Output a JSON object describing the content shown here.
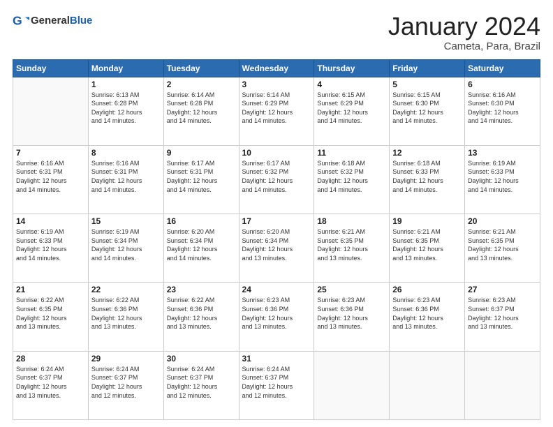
{
  "logo": {
    "general": "General",
    "blue": "Blue"
  },
  "header": {
    "title": "January 2024",
    "subtitle": "Cameta, Para, Brazil"
  },
  "weekdays": [
    "Sunday",
    "Monday",
    "Tuesday",
    "Wednesday",
    "Thursday",
    "Friday",
    "Saturday"
  ],
  "weeks": [
    [
      {
        "day": "",
        "info": ""
      },
      {
        "day": "1",
        "info": "Sunrise: 6:13 AM\nSunset: 6:28 PM\nDaylight: 12 hours\nand 14 minutes."
      },
      {
        "day": "2",
        "info": "Sunrise: 6:14 AM\nSunset: 6:28 PM\nDaylight: 12 hours\nand 14 minutes."
      },
      {
        "day": "3",
        "info": "Sunrise: 6:14 AM\nSunset: 6:29 PM\nDaylight: 12 hours\nand 14 minutes."
      },
      {
        "day": "4",
        "info": "Sunrise: 6:15 AM\nSunset: 6:29 PM\nDaylight: 12 hours\nand 14 minutes."
      },
      {
        "day": "5",
        "info": "Sunrise: 6:15 AM\nSunset: 6:30 PM\nDaylight: 12 hours\nand 14 minutes."
      },
      {
        "day": "6",
        "info": "Sunrise: 6:16 AM\nSunset: 6:30 PM\nDaylight: 12 hours\nand 14 minutes."
      }
    ],
    [
      {
        "day": "7",
        "info": "Sunrise: 6:16 AM\nSunset: 6:31 PM\nDaylight: 12 hours\nand 14 minutes."
      },
      {
        "day": "8",
        "info": "Sunrise: 6:16 AM\nSunset: 6:31 PM\nDaylight: 12 hours\nand 14 minutes."
      },
      {
        "day": "9",
        "info": "Sunrise: 6:17 AM\nSunset: 6:31 PM\nDaylight: 12 hours\nand 14 minutes."
      },
      {
        "day": "10",
        "info": "Sunrise: 6:17 AM\nSunset: 6:32 PM\nDaylight: 12 hours\nand 14 minutes."
      },
      {
        "day": "11",
        "info": "Sunrise: 6:18 AM\nSunset: 6:32 PM\nDaylight: 12 hours\nand 14 minutes."
      },
      {
        "day": "12",
        "info": "Sunrise: 6:18 AM\nSunset: 6:33 PM\nDaylight: 12 hours\nand 14 minutes."
      },
      {
        "day": "13",
        "info": "Sunrise: 6:19 AM\nSunset: 6:33 PM\nDaylight: 12 hours\nand 14 minutes."
      }
    ],
    [
      {
        "day": "14",
        "info": "Sunrise: 6:19 AM\nSunset: 6:33 PM\nDaylight: 12 hours\nand 14 minutes."
      },
      {
        "day": "15",
        "info": "Sunrise: 6:19 AM\nSunset: 6:34 PM\nDaylight: 12 hours\nand 14 minutes."
      },
      {
        "day": "16",
        "info": "Sunrise: 6:20 AM\nSunset: 6:34 PM\nDaylight: 12 hours\nand 14 minutes."
      },
      {
        "day": "17",
        "info": "Sunrise: 6:20 AM\nSunset: 6:34 PM\nDaylight: 12 hours\nand 13 minutes."
      },
      {
        "day": "18",
        "info": "Sunrise: 6:21 AM\nSunset: 6:35 PM\nDaylight: 12 hours\nand 13 minutes."
      },
      {
        "day": "19",
        "info": "Sunrise: 6:21 AM\nSunset: 6:35 PM\nDaylight: 12 hours\nand 13 minutes."
      },
      {
        "day": "20",
        "info": "Sunrise: 6:21 AM\nSunset: 6:35 PM\nDaylight: 12 hours\nand 13 minutes."
      }
    ],
    [
      {
        "day": "21",
        "info": "Sunrise: 6:22 AM\nSunset: 6:35 PM\nDaylight: 12 hours\nand 13 minutes."
      },
      {
        "day": "22",
        "info": "Sunrise: 6:22 AM\nSunset: 6:36 PM\nDaylight: 12 hours\nand 13 minutes."
      },
      {
        "day": "23",
        "info": "Sunrise: 6:22 AM\nSunset: 6:36 PM\nDaylight: 12 hours\nand 13 minutes."
      },
      {
        "day": "24",
        "info": "Sunrise: 6:23 AM\nSunset: 6:36 PM\nDaylight: 12 hours\nand 13 minutes."
      },
      {
        "day": "25",
        "info": "Sunrise: 6:23 AM\nSunset: 6:36 PM\nDaylight: 12 hours\nand 13 minutes."
      },
      {
        "day": "26",
        "info": "Sunrise: 6:23 AM\nSunset: 6:36 PM\nDaylight: 12 hours\nand 13 minutes."
      },
      {
        "day": "27",
        "info": "Sunrise: 6:23 AM\nSunset: 6:37 PM\nDaylight: 12 hours\nand 13 minutes."
      }
    ],
    [
      {
        "day": "28",
        "info": "Sunrise: 6:24 AM\nSunset: 6:37 PM\nDaylight: 12 hours\nand 13 minutes."
      },
      {
        "day": "29",
        "info": "Sunrise: 6:24 AM\nSunset: 6:37 PM\nDaylight: 12 hours\nand 12 minutes."
      },
      {
        "day": "30",
        "info": "Sunrise: 6:24 AM\nSunset: 6:37 PM\nDaylight: 12 hours\nand 12 minutes."
      },
      {
        "day": "31",
        "info": "Sunrise: 6:24 AM\nSunset: 6:37 PM\nDaylight: 12 hours\nand 12 minutes."
      },
      {
        "day": "",
        "info": ""
      },
      {
        "day": "",
        "info": ""
      },
      {
        "day": "",
        "info": ""
      }
    ]
  ]
}
